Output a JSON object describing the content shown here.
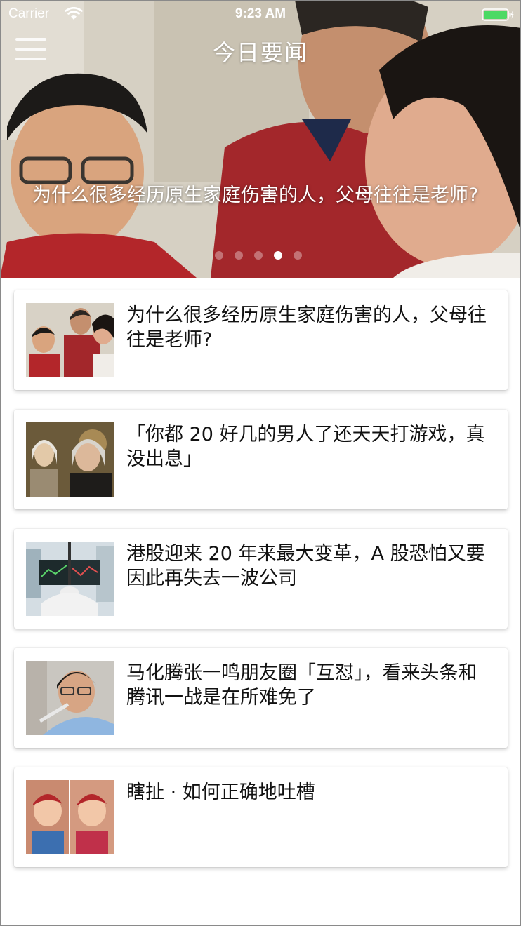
{
  "status_bar": {
    "carrier": "Carrier",
    "time": "9:23 AM"
  },
  "nav": {
    "title": "今日要闻",
    "menu_icon": "hamburger-menu-icon"
  },
  "hero": {
    "caption": "为什么很多经历原生家庭伤害的人，父母往往是老师?",
    "page_count": 5,
    "active_page": 4
  },
  "news": [
    {
      "title": "为什么很多经历原生家庭伤害的人，父母往往是老师?",
      "thumb": "family-photo"
    },
    {
      "title": "「你都 20 好几的男人了还天天打游戏，真没出息」",
      "thumb": "movie-still-photo"
    },
    {
      "title": "港股迎来 20 年来最大变革，A 股恐怕又要因此再失去一波公司",
      "thumb": "stock-screen-photo"
    },
    {
      "title": "马化腾张一鸣朋友圈「互怼」，看来头条和腾讯一战是在所难免了",
      "thumb": "businessman-photo"
    },
    {
      "title": "瞎扯 · 如何正确地吐槽",
      "thumb": "children-costume-photo"
    }
  ],
  "colors": {
    "battery": "#4cd964",
    "text": "#111111"
  }
}
